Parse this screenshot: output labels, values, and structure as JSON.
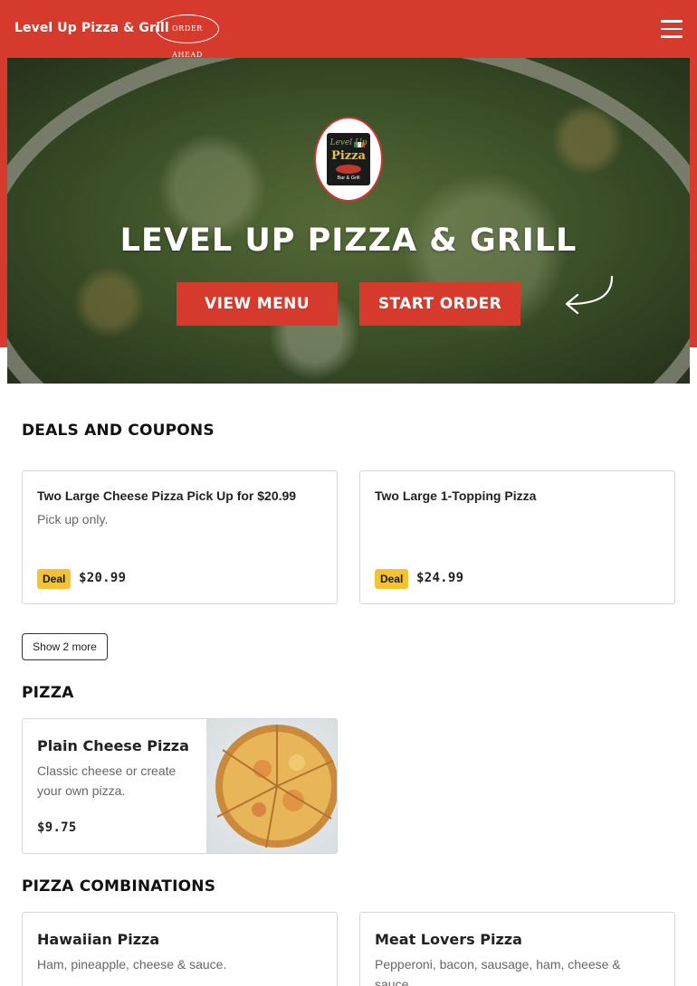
{
  "header": {
    "brand": "Level Up Pizza & Grill",
    "order_ahead": "ORDER AHEAD",
    "menu_icon": "hamburger-icon"
  },
  "hero": {
    "title": "LEVEL UP PIZZA & GRILL",
    "view_menu": "VIEW MENU",
    "start_order": "START ORDER",
    "logo": {
      "line1": "Level Up",
      "line2": "Pizza",
      "line3": "Bar & Grill"
    },
    "arrow_icon": "curved-arrow-icon"
  },
  "deals": {
    "title": "DEALS AND COUPONS",
    "items": [
      {
        "name": "Two Large Cheese Pizza Pick Up for $20.99",
        "desc": "Pick up only.",
        "badge": "Deal",
        "price": "$20.99"
      },
      {
        "name": "Two Large 1-Topping Pizza",
        "desc": "",
        "badge": "Deal",
        "price": "$24.99"
      }
    ],
    "show_more": "Show 2 more"
  },
  "pizza": {
    "title": "PIZZA",
    "items": [
      {
        "name": "Plain Cheese Pizza",
        "desc_line1": "Classic cheese or create",
        "desc_line2": "your own pizza.",
        "price": "$9.75"
      }
    ]
  },
  "combos": {
    "title": "PIZZA COMBINATIONS",
    "items": [
      {
        "name": "Hawaiian Pizza",
        "desc": "Ham, pineapple, cheese & sauce."
      },
      {
        "name": "Meat Lovers Pizza",
        "desc_line1": "Pepperoni, bacon, sausage, ham, cheese &",
        "desc_line2": "sauce."
      }
    ]
  },
  "colors": {
    "brand_red": "#d63a2c",
    "deal_badge": "#f5c233"
  }
}
